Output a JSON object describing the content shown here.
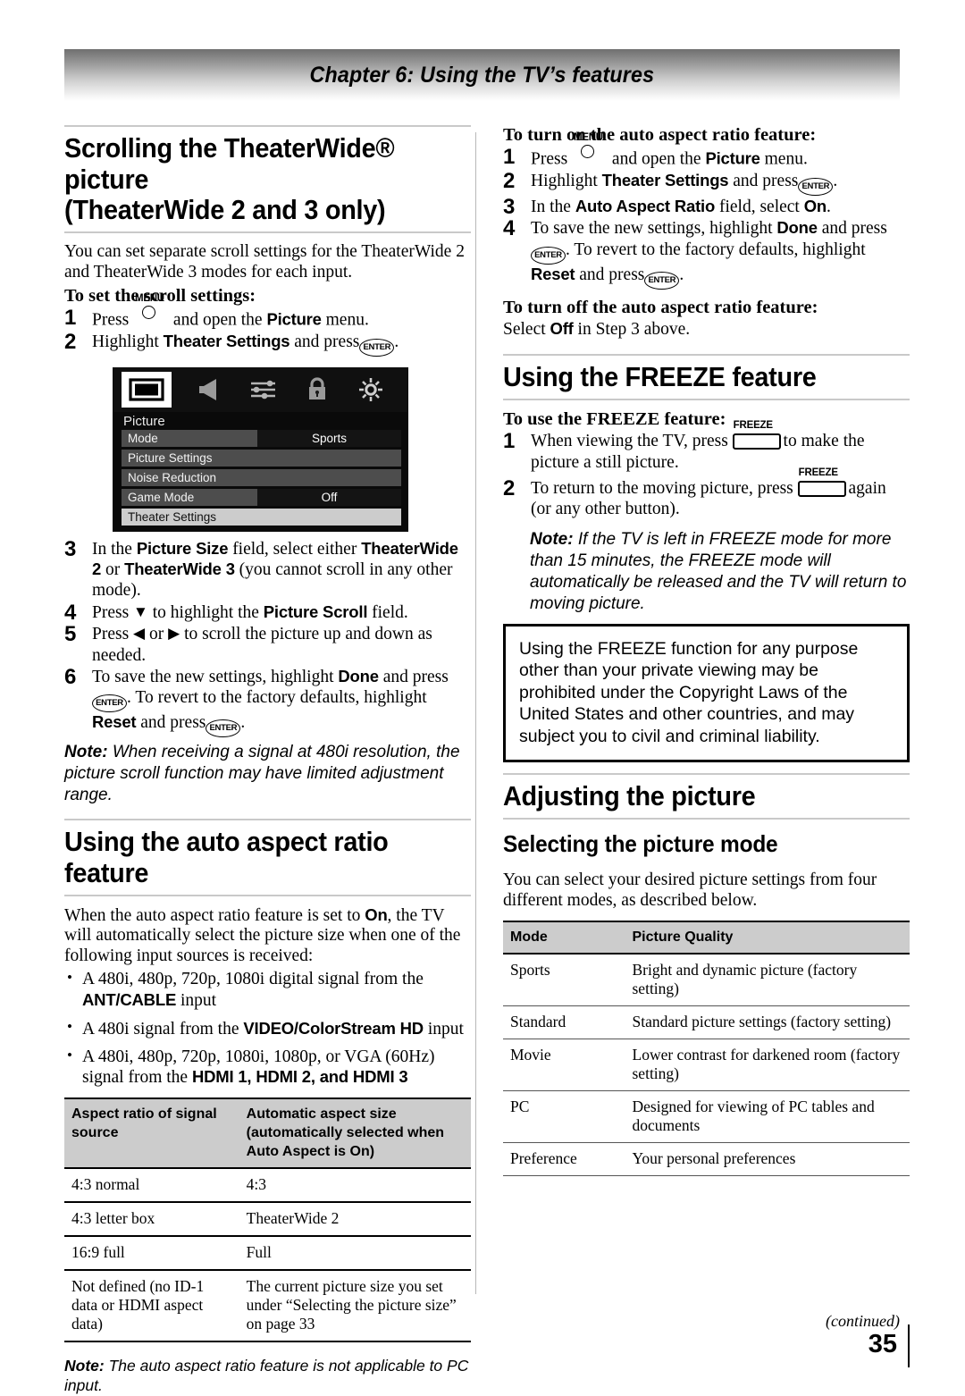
{
  "header": {
    "chapter_title": "Chapter 6: Using the TV’s features"
  },
  "left_column": {
    "section1": {
      "heading_line1": "Scrolling the TheaterWide® picture",
      "heading_line2": "(TheaterWide 2 and 3 only)",
      "intro": "You can set separate scroll settings for the TheaterWide 2 and TheaterWide 3 modes for each input.",
      "lead": "To set the scroll settings:",
      "step1_a": "Press",
      "step1_b": "and open the",
      "step1_bold": "Picture",
      "step1_c": "menu.",
      "step2_a": "Highlight",
      "step2_bold": "Theater Settings",
      "step2_b": "and press",
      "step2_c": ".",
      "step3_a": "In the",
      "step3_bold1": "Picture Size",
      "step3_b": "field, select either",
      "step3_bold2": "TheaterWide 2",
      "step3_c": "or",
      "step3_bold3": "TheaterWide 3",
      "step3_d": "(you cannot scroll in any other mode).",
      "step4_a": "Press",
      "step4_arrow": "▼",
      "step4_b": "to highlight the",
      "step4_bold": "Picture Scroll",
      "step4_c": "field.",
      "step5_a": "Press",
      "step5_arrow1": "◀",
      "step5_or": "or",
      "step5_arrow2": "▶",
      "step5_b": "to scroll the picture up and down as needed.",
      "step6_a": "To save the new settings, highlight",
      "step6_bold1": "Done",
      "step6_b": "and press",
      "step6_c": ". To revert to the factory defaults, highlight",
      "step6_bold2": "Reset",
      "step6_d": "and press",
      "step6_e": ".",
      "note_label": "Note:",
      "note_text": "When receiving a signal at 480i resolution, the picture scroll function may have limited adjustment range."
    },
    "tv_menu": {
      "icons": [
        {
          "name": "picture-icon",
          "selected": true
        },
        {
          "name": "audio-speaker-icon",
          "selected": false
        },
        {
          "name": "sliders-settings-icon",
          "selected": false
        },
        {
          "name": "lock-icon",
          "selected": false
        },
        {
          "name": "brightness-gear-icon",
          "selected": false
        }
      ],
      "title": "Picture",
      "rows": [
        {
          "label": "Mode",
          "value": "Sports",
          "highlighted": false,
          "has_value": true
        },
        {
          "label": "Picture Settings",
          "value": "",
          "highlighted": false,
          "has_value": false
        },
        {
          "label": "Noise Reduction",
          "value": "",
          "highlighted": false,
          "has_value": false
        },
        {
          "label": "Game Mode",
          "value": "Off",
          "highlighted": false,
          "has_value": true
        },
        {
          "label": "Theater Settings",
          "value": "",
          "highlighted": true,
          "has_value": false
        }
      ]
    },
    "section2": {
      "heading": "Using the auto aspect ratio feature",
      "intro_a": "When the auto aspect ratio feature is set to",
      "intro_bold": "On",
      "intro_b": ", the TV will automatically select the picture size when one of the following input sources is received:",
      "bullet1_a": "A 480i, 480p, 720p, 1080i digital signal from the",
      "bullet1_bold": "ANT/CABLE",
      "bullet1_b": "input",
      "bullet2_a": "A 480i signal from the",
      "bullet2_bold": "VIDEO/ColorStream HD",
      "bullet2_b": "input",
      "bullet3_a": "A 480i, 480p, 720p, 1080i, 1080p, or VGA (60Hz) signal from the",
      "bullet3_bold": "HDMI 1, HDMI 2, and HDMI 3",
      "note_label": "Note:",
      "note_text": "The auto aspect ratio feature is not applicable to PC input."
    },
    "aspect_table": {
      "headers": [
        "Aspect ratio of signal source",
        "Automatic aspect size (automatically selected when Auto Aspect is On)"
      ],
      "rows": [
        [
          "4:3 normal",
          "4:3"
        ],
        [
          "4:3 letter box",
          "TheaterWide 2"
        ],
        [
          "16:9 full",
          "Full"
        ],
        [
          "Not defined (no ID-1 data or HDMI aspect data)",
          "The current picture size you set under “Selecting the picture size” on page 33"
        ]
      ]
    }
  },
  "right_column": {
    "auto_aspect_on": {
      "lead": "To turn on the auto aspect ratio feature:",
      "step1_a": "Press",
      "step1_b": "and open the",
      "step1_bold": "Picture",
      "step1_c": "menu.",
      "step2_a": "Highlight",
      "step2_bold": "Theater Settings",
      "step2_b": "and press",
      "step2_c": ".",
      "step3_a": "In the",
      "step3_bold1": "Auto Aspect Ratio",
      "step3_b": "field, select",
      "step3_bold2": "On",
      "step3_c": ".",
      "step4_a": "To save the new settings, highlight",
      "step4_bold1": "Done",
      "step4_b": "and press",
      "step4_c": ". To revert to the factory defaults, highlight",
      "step4_bold2": "Reset",
      "step4_d": "and press",
      "step4_e": "."
    },
    "auto_aspect_off": {
      "lead": "To turn off the auto aspect ratio feature:",
      "text_a": "Select",
      "text_bold": "Off",
      "text_b": "in Step 3 above."
    },
    "freeze": {
      "heading": "Using the FREEZE feature",
      "lead": "To use the FREEZE feature:",
      "step1_a": "When viewing the TV, press",
      "step1_b": "to make the picture a still picture.",
      "step2_a": "To return to the moving picture, press",
      "step2_b": "again (or any other button).",
      "note_label": "Note:",
      "note_text": "If the TV is left in FREEZE mode for more than 15 minutes, the FREEZE mode will automatically be released and the TV will return to moving picture.",
      "warning_box": "Using the FREEZE function for any purpose other than your private viewing may be prohibited under the Copyright Laws of the United States and other countries, and may subject you to civil and criminal liability."
    },
    "adjusting": {
      "heading": "Adjusting the picture",
      "subheading": "Selecting the picture mode",
      "intro": "You can select your desired picture settings from four different modes, as described below."
    },
    "mode_table": {
      "headers": [
        "Mode",
        "Picture Quality"
      ],
      "rows": [
        [
          "Sports",
          "Bright and dynamic picture (factory setting)"
        ],
        [
          "Standard",
          "Standard picture settings (factory setting)"
        ],
        [
          "Movie",
          "Lower contrast for darkened room (factory setting)"
        ],
        [
          "PC",
          "Designed for viewing of PC tables and documents"
        ],
        [
          "Preference",
          "Your personal preferences"
        ]
      ]
    }
  },
  "footer": {
    "continued": "(continued)",
    "page_number": "35"
  },
  "glyphs": {
    "menu_label": "MENU",
    "enter_label": "ENTER",
    "freeze_label": "FREEZE"
  }
}
